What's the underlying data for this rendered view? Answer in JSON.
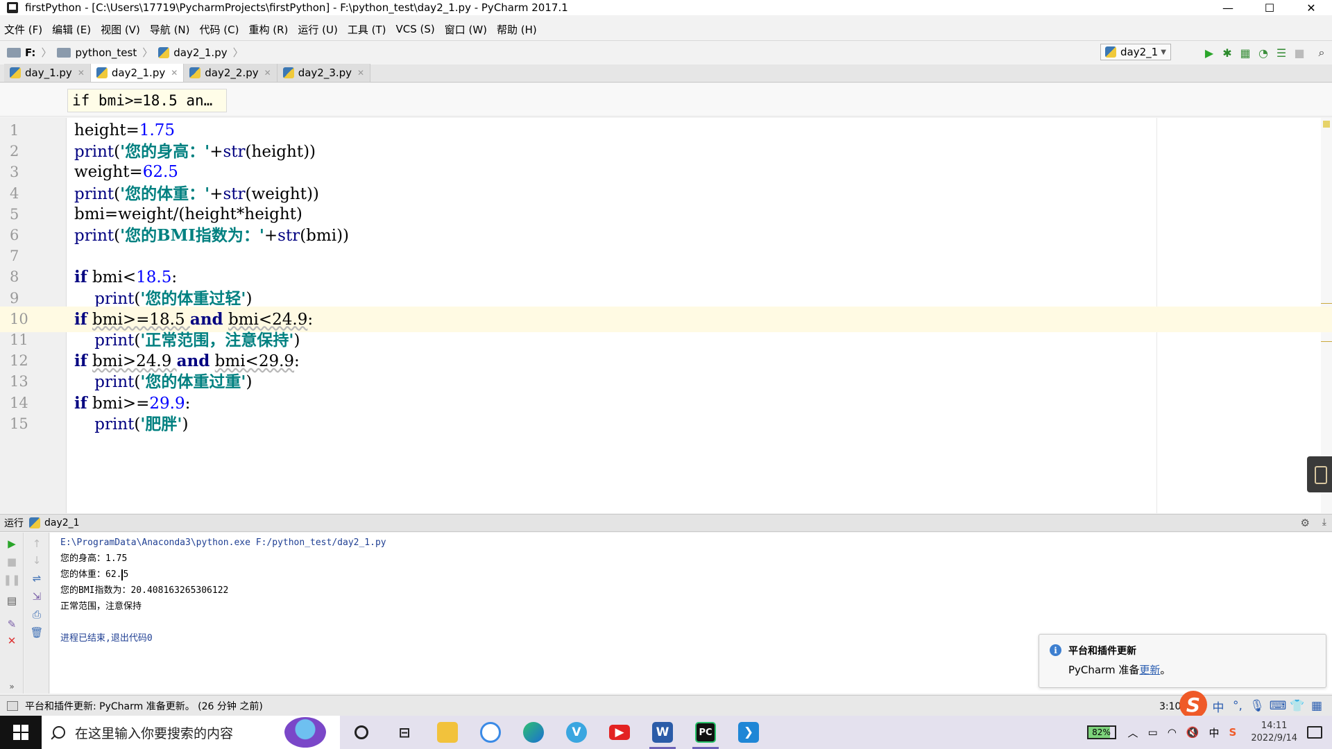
{
  "window": {
    "title": "firstPython - [C:\\Users\\17719\\PycharmProjects\\firstPython] - F:\\python_test\\day2_1.py - PyCharm 2017.1",
    "controls": {
      "minimize": "—",
      "maximize": "☐",
      "close": "✕"
    }
  },
  "menu": [
    "文件 (F)",
    "编辑 (E)",
    "视图 (V)",
    "导航 (N)",
    "代码 (C)",
    "重构 (R)",
    "运行 (U)",
    "工具 (T)",
    "VCS (S)",
    "窗口 (W)",
    "帮助 (H)"
  ],
  "nav": {
    "drive": "F:",
    "folder": "python_test",
    "file": "day2_1.py",
    "run_config": "day2_1"
  },
  "tabs": [
    {
      "label": "day_1.py",
      "active": false
    },
    {
      "label": "day2_1.py",
      "active": true
    },
    {
      "label": "day2_2.py",
      "active": false
    },
    {
      "label": "day2_3.py",
      "active": false
    }
  ],
  "editor": {
    "breadcrumb": "if bmi>=18.5 an…",
    "current_line": 10,
    "lines": [
      {
        "n": "1",
        "parts": [
          [
            "",
            "height="
          ],
          [
            "num",
            "1.75"
          ]
        ]
      },
      {
        "n": "2",
        "parts": [
          [
            "fn",
            "print"
          ],
          [
            "",
            "("
          ],
          [
            "str",
            "'您的身高：'"
          ],
          [
            "",
            "+"
          ],
          [
            "fn",
            "str"
          ],
          [
            "",
            "(height))"
          ]
        ]
      },
      {
        "n": "3",
        "parts": [
          [
            "",
            "weight="
          ],
          [
            "num",
            "62.5"
          ]
        ]
      },
      {
        "n": "4",
        "parts": [
          [
            "fn",
            "print"
          ],
          [
            "",
            "("
          ],
          [
            "str",
            "'您的体重：'"
          ],
          [
            "",
            "+"
          ],
          [
            "fn",
            "str"
          ],
          [
            "",
            "(weight))"
          ]
        ]
      },
      {
        "n": "5",
        "parts": [
          [
            "",
            "bmi=weight/(height*height)"
          ]
        ]
      },
      {
        "n": "6",
        "parts": [
          [
            "fn",
            "print"
          ],
          [
            "",
            "("
          ],
          [
            "str",
            "'您的BMI指数为：'"
          ],
          [
            "",
            "+"
          ],
          [
            "fn",
            "str"
          ],
          [
            "",
            "(bmi))"
          ]
        ]
      },
      {
        "n": "7",
        "parts": []
      },
      {
        "n": "8",
        "parts": [
          [
            "kw",
            "if"
          ],
          [
            "",
            " bmi<"
          ],
          [
            "num",
            "18.5"
          ],
          [
            "",
            ":"
          ]
        ]
      },
      {
        "n": "9",
        "parts": [
          [
            "",
            "    "
          ],
          [
            "fn",
            "print"
          ],
          [
            "",
            "("
          ],
          [
            "str",
            "'您的体重过轻'"
          ],
          [
            "",
            ")"
          ]
        ]
      },
      {
        "n": "10",
        "parts": [
          [
            "kw",
            "if"
          ],
          [
            "",
            " "
          ],
          [
            "wavy",
            "bmi>=18.5 "
          ],
          [
            "kw",
            "and"
          ],
          [
            "",
            " "
          ],
          [
            "wavy",
            "bmi<24.9"
          ],
          [
            "",
            ":"
          ]
        ]
      },
      {
        "n": "11",
        "parts": [
          [
            "",
            "    "
          ],
          [
            "fn",
            "print"
          ],
          [
            "",
            "("
          ],
          [
            "str",
            "'正常范围，注意保持'"
          ],
          [
            "",
            ")"
          ]
        ]
      },
      {
        "n": "12",
        "parts": [
          [
            "kw",
            "if"
          ],
          [
            "",
            " "
          ],
          [
            "wavy",
            "bmi>24.9 "
          ],
          [
            "kw",
            "and"
          ],
          [
            "",
            " "
          ],
          [
            "wavy",
            "bmi<29.9"
          ],
          [
            "",
            ":"
          ]
        ]
      },
      {
        "n": "13",
        "parts": [
          [
            "",
            "    "
          ],
          [
            "fn",
            "print"
          ],
          [
            "",
            "("
          ],
          [
            "str",
            "'您的体重过重'"
          ],
          [
            "",
            ")"
          ]
        ]
      },
      {
        "n": "14",
        "parts": [
          [
            "kw",
            "if"
          ],
          [
            "",
            " bmi>="
          ],
          [
            "num",
            "29.9"
          ],
          [
            "",
            ":"
          ]
        ]
      },
      {
        "n": "15",
        "parts": [
          [
            "",
            "    "
          ],
          [
            "fn",
            "print"
          ],
          [
            "",
            "("
          ],
          [
            "str",
            "'肥胖'"
          ],
          [
            "",
            ")"
          ]
        ]
      }
    ]
  },
  "run": {
    "label": "运行",
    "config": "day2_1",
    "console": {
      "command": "E:\\ProgramData\\Anaconda3\\python.exe F:/python_test/day2_1.py",
      "out1": "您的身高：1.75",
      "out2_prefix": "您的体重：62.",
      "out2_suffix": "5",
      "out3": "您的BMI指数为：20.408163265306122",
      "out4": "正常范围，注意保持",
      "exit": "进程已结束,退出代码0"
    }
  },
  "notification": {
    "title": "平台和插件更新",
    "body_prefix": "PyCharm 准备",
    "link": "更新",
    "body_suffix": "。"
  },
  "status": {
    "message": "平台和插件更新: PyCharm 准备更新。 (26 分钟 之前)",
    "position": "3:10"
  },
  "ime": {
    "lang": "中",
    "punct": "°,",
    "sogou": "S"
  },
  "taskbar": {
    "search_placeholder": "在这里输入你要搜索的内容",
    "battery": "82%",
    "lang": "中",
    "time": "14:11",
    "date": "2022/9/14"
  },
  "colors": {
    "keyword": "#000080",
    "number": "#0000ff",
    "string": "#008080",
    "current_line": "#fffae3",
    "run_green": "#2aa52a",
    "link": "#2a5db0"
  }
}
